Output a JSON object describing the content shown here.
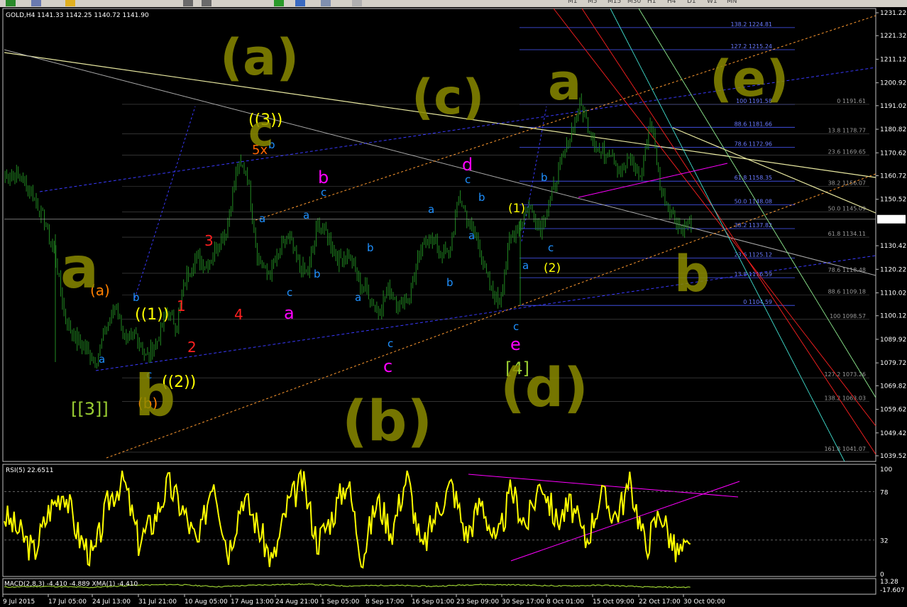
{
  "toolbar": {
    "timeframes": [
      "M1",
      "M5",
      "M15",
      "M30",
      "H1",
      "H4",
      "D1",
      "W1",
      "MN"
    ]
  },
  "main_header": {
    "symbol": "GOLD,H4",
    "ohlc": "1141.33 1142.25 1140.72 1141.90"
  },
  "rsi_header": "RSI(5) 22.6511",
  "macd_header": "MACD(2,8,3) -4.410 -4.889 XMA(1) -4.410",
  "price_axis": [
    "1231.22",
    "1221.32",
    "1211.12",
    "1200.92",
    "1191.02",
    "1180.82",
    "1170.62",
    "1160.72",
    "1150.52",
    "1141.90",
    "1130.42",
    "1120.22",
    "1110.02",
    "1100.12",
    "1089.92",
    "1079.72",
    "1069.82",
    "1059.62",
    "1049.42",
    "1039.52"
  ],
  "current_price": "1141.90",
  "rsi_axis": [
    "100",
    "78",
    "32",
    "0"
  ],
  "macd_axis": [
    "13.28",
    "-17.607"
  ],
  "time_axis": [
    "9 Jul 2015",
    "17 Jul 05:00",
    "24 Jul 13:00",
    "31 Jul 21:00",
    "10 Aug 05:00",
    "17 Aug 13:00",
    "24 Aug 21:00",
    "1 Sep 05:00",
    "8 Sep 17:00",
    "16 Sep 01:00",
    "23 Sep 09:00",
    "30 Sep 17:00",
    "8 Oct 01:00",
    "15 Oct 09:00",
    "22 Oct 17:00",
    "30 Oct 00:00"
  ],
  "fib_right_labels": [
    "138.2 1224.81",
    "127.2 1215.24",
    "100 1191.58",
    "88.6 1181.66",
    "78.6 1172.96",
    "61.8 1158.35",
    "50.0 1148.08",
    "38.2 1137.82",
    "23.6 1125.12",
    "13.8 1116.59",
    "0 1104.59"
  ],
  "fib_left_labels": [
    "0 1191.61",
    "13.8 1178.77",
    "23.6 1169.65",
    "38.2 1156.07",
    "50.0 1145.09",
    "61.8 1134.11",
    "78.6 1118.48",
    "88.6 1109.18",
    "100 1098.57",
    "127.2 1073.26",
    "138.2 1063.03",
    "161.8 1041.07"
  ],
  "wave_labels": [
    {
      "t": "a",
      "c": "#1e90ff"
    },
    {
      "t": "b",
      "c": "#1e90ff"
    },
    {
      "t": "c",
      "c": "#1e90ff"
    },
    {
      "t": "a",
      "c": "#1e90ff"
    },
    {
      "t": "b",
      "c": "#1e90ff"
    },
    {
      "t": "c",
      "c": "#1e90ff"
    },
    {
      "t": "a",
      "c": "#1e90ff"
    },
    {
      "t": "b",
      "c": "#1e90ff"
    },
    {
      "t": "c",
      "c": "#1e90ff"
    },
    {
      "t": "a",
      "c": "#1e90ff"
    },
    {
      "t": "b",
      "c": "#1e90ff"
    },
    {
      "t": "c",
      "c": "#1e90ff"
    },
    {
      "t": "a",
      "c": "#1e90ff"
    },
    {
      "t": "b",
      "c": "#1e90ff"
    },
    {
      "t": "c",
      "c": "#1e90ff"
    },
    {
      "t": "a",
      "c": "#1e90ff"
    },
    {
      "t": "b",
      "c": "#1e90ff"
    },
    {
      "t": "c",
      "c": "#1e90ff"
    },
    {
      "t": "c",
      "c": "#1e90ff"
    },
    {
      "t": "a",
      "c": "#1e90ff"
    },
    {
      "t": "b",
      "c": "#1e90ff"
    },
    {
      "t": "c",
      "c": "#1e90ff"
    },
    {
      "t": "c",
      "c": "#22aa22"
    },
    {
      "t": "1",
      "c": "#ff2020"
    },
    {
      "t": "2",
      "c": "#ff2020"
    },
    {
      "t": "3",
      "c": "#ff2020"
    },
    {
      "t": "4",
      "c": "#ff2020"
    },
    {
      "t": "5x",
      "c": "#ff6600"
    },
    {
      "t": "(a)",
      "c": "#ff8000"
    },
    {
      "t": "(b)",
      "c": "#ff8000"
    },
    {
      "t": "((1))",
      "c": "#ffff00"
    },
    {
      "t": "((2))",
      "c": "#ffff00"
    },
    {
      "t": "((3))",
      "c": "#ffff00"
    },
    {
      "t": "(1)",
      "c": "#ffff00"
    },
    {
      "t": "(2)",
      "c": "#ffff00"
    },
    {
      "t": "[[3]]",
      "c": "#9acd32"
    },
    {
      "t": "[4]",
      "c": "#9acd32"
    },
    {
      "t": "a",
      "c": "#ff00ff"
    },
    {
      "t": "b",
      "c": "#ff00ff"
    },
    {
      "t": "c",
      "c": "#ff00ff"
    },
    {
      "t": "d",
      "c": "#ff00ff"
    },
    {
      "t": "e",
      "c": "#ff00ff"
    }
  ],
  "handwritten": [
    "(a)",
    "(b)",
    "(c)",
    "(d)",
    "a",
    "b",
    "c",
    "a",
    "b",
    "(e)",
    "c"
  ],
  "colors": {
    "background": "#000000",
    "candles": "#228b22",
    "rsi_line": "#ffff00",
    "macd_line": "#9acd32",
    "handwriting": "#8a8a00",
    "fib_lines": "#4a5aff",
    "trendline_yellow": "#e8e8a0",
    "channel_magenta": "#ff00ff"
  },
  "chart_data": [
    {
      "type": "line",
      "title": "GOLD,H4",
      "xlabel": "",
      "ylabel": "",
      "x": [
        "9 Jul 2015",
        "17 Jul 05:00",
        "24 Jul 13:00",
        "31 Jul 21:00",
        "10 Aug 05:00",
        "17 Aug 13:00",
        "24 Aug 21:00",
        "1 Sep 05:00",
        "8 Sep 17:00",
        "16 Sep 01:00",
        "23 Sep 09:00",
        "30 Sep 17:00",
        "8 Oct 01:00",
        "15 Oct 09:00",
        "22 Oct 17:00",
        "30 Oct 00:00"
      ],
      "series": [
        {
          "values": [
            1160,
            1098,
            1086,
            1096,
            1118,
            1128,
            1130,
            1140,
            1122,
            1126,
            1130,
            1126,
            1145,
            1178,
            1163,
            1142
          ]
        }
      ],
      "anchors": [
        1160,
        1162,
        1158,
        1150,
        1140,
        1125,
        1098,
        1090,
        1086,
        1080,
        1095,
        1105,
        1088,
        1092,
        1082,
        1088,
        1102,
        1096,
        1118,
        1126,
        1122,
        1130,
        1138,
        1165,
        1162,
        1126,
        1118,
        1125,
        1135,
        1123,
        1118,
        1140,
        1135,
        1124,
        1128,
        1115,
        1110,
        1102,
        1112,
        1105,
        1108,
        1125,
        1135,
        1128,
        1126,
        1152,
        1140,
        1130,
        1112,
        1106,
        1132,
        1140,
        1148,
        1138,
        1150,
        1165,
        1178,
        1192,
        1180,
        1170,
        1172,
        1162,
        1168,
        1160,
        1185,
        1155,
        1145,
        1138,
        1141
      ],
      "ylim": [
        1039.52,
        1231.22
      ],
      "current": 1141.9
    },
    {
      "type": "line",
      "title": "RSI(5) 22.6511",
      "levels": [
        78,
        32
      ],
      "ylim": [
        0,
        100
      ],
      "series": [
        {
          "values": [
            55,
            40,
            20,
            60,
            80,
            35,
            15,
            70,
            90,
            30,
            50,
            85,
            60,
            25,
            95,
            20,
            75,
            45,
            10,
            65,
            88,
            30,
            55,
            90,
            15,
            70,
            40,
            95,
            20,
            60,
            85,
            35,
            70,
            25,
            80,
            45,
            90,
            50,
            65,
            30,
            75,
            55,
            85,
            25,
            60,
            20,
            22
          ]
        }
      ]
    },
    {
      "type": "line",
      "title": "MACD(2,8,3) -4.410 -4.889 XMA(1) -4.410",
      "ylim": [
        -17.607,
        13.28
      ],
      "series": [
        {
          "values": [
            -4,
            -2,
            -5,
            1,
            3,
            -3,
            2,
            4,
            -1,
            1,
            -2,
            3,
            2,
            -1,
            1,
            -4,
            -4.41
          ]
        }
      ]
    }
  ]
}
